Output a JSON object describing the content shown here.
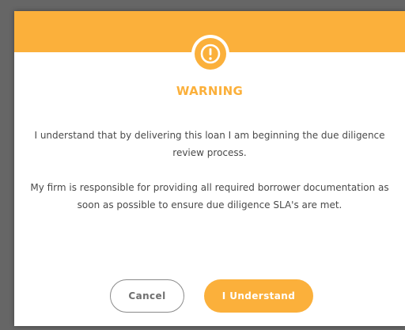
{
  "dialog": {
    "title": "WARNING",
    "icon": "warning-exclamation-icon",
    "message_1": "I understand that by delivering this loan I am beginning the due diligence review process.",
    "message_2": "My firm is responsible for providing all required borrower documentation as soon as possible to ensure due diligence SLA's are met.",
    "cancel_label": "Cancel",
    "confirm_label": "I Understand"
  },
  "colors": {
    "accent": "#fbb03b",
    "text": "#4a4a4a",
    "cancel_border": "#8a8a8a"
  }
}
